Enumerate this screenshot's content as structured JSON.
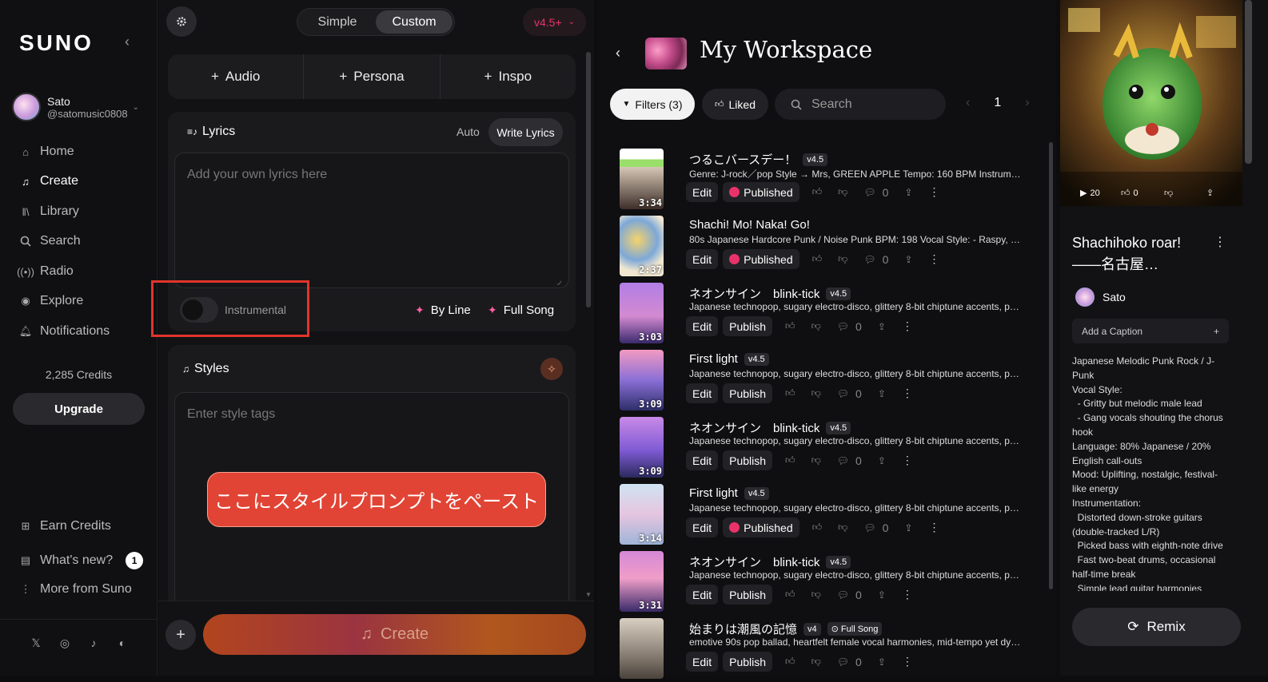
{
  "sidebar": {
    "logo": "SUNO",
    "user": {
      "name": "Sato",
      "handle": "@satomusic0808"
    },
    "nav": [
      {
        "label": "Home",
        "icon": "home-icon"
      },
      {
        "label": "Create",
        "icon": "create-icon"
      },
      {
        "label": "Library",
        "icon": "library-icon"
      },
      {
        "label": "Search",
        "icon": "search-icon"
      },
      {
        "label": "Radio",
        "icon": "radio-icon"
      },
      {
        "label": "Explore",
        "icon": "explore-icon"
      },
      {
        "label": "Notifications",
        "icon": "bell-icon"
      }
    ],
    "credits": "2,285 Credits",
    "upgrade": "Upgrade",
    "footer": [
      {
        "label": "Earn Credits",
        "icon": "gift-icon"
      },
      {
        "label": "What's new?",
        "icon": "news-icon",
        "badge": "1"
      },
      {
        "label": "More from Suno",
        "icon": "more-icon"
      }
    ],
    "social": [
      "x-icon",
      "instagram-icon",
      "tiktok-icon",
      "discord-icon"
    ]
  },
  "create": {
    "mode_simple": "Simple",
    "mode_custom": "Custom",
    "version": "v4.5+",
    "add_audio": "Audio",
    "add_persona": "Persona",
    "add_inspo": "Inspo",
    "lyrics_title": "Lyrics",
    "lyrics_auto": "Auto",
    "lyrics_write": "Write Lyrics",
    "lyrics_placeholder": "Add your own lyrics here",
    "instrumental": "Instrumental",
    "by_line": "By Line",
    "full_song": "Full Song",
    "styles_title": "Styles",
    "styles_placeholder": "Enter style tags",
    "callout": "ここにスタイルプロンプトをペースト",
    "create_button": "Create"
  },
  "workspace": {
    "title": "My Workspace",
    "filters": "Filters (3)",
    "liked": "Liked",
    "search_placeholder": "Search",
    "page": "1",
    "songs": [
      {
        "title": "つるこバースデー！",
        "version": "v4.5",
        "desc": "Genre: J-rock／pop Style → Mrs, GREEN APPLE Tempo: 160 BPM Instruments: • Electric guitars",
        "duration": "3:34",
        "status": "Published",
        "comments": "0"
      },
      {
        "title": "Shachi! Mo! Naka! Go!",
        "version": "",
        "desc": "80s Japanese Hardcore Punk / Noise Punk BPM: 198 Vocal Style: - Raspy, half-spoken shouting",
        "duration": "2:37",
        "status": "Published",
        "comments": "0"
      },
      {
        "title": "ネオンサイン　blink-tick",
        "version": "v4.5",
        "desc": "Japanese technopop, sugary electro-disco, glittery 8-bit chiptune accents, punchy four-on-the-floor",
        "duration": "3:03",
        "status": "Publish",
        "comments": "0"
      },
      {
        "title": "First light",
        "version": "v4.5",
        "desc": "Japanese technopop, sugary electro-disco, glittery 8-bit chiptune accents, punchy four-on-the-floor",
        "duration": "3:09",
        "status": "Publish",
        "comments": "0"
      },
      {
        "title": "ネオンサイン　blink-tick",
        "version": "v4.5",
        "desc": "Japanese technopop, sugary electro-disco, glittery 8-bit chiptune accents, punchy four-on-the-floor",
        "duration": "3:09",
        "status": "Publish",
        "comments": "0"
      },
      {
        "title": "First light",
        "version": "v4.5",
        "desc": "Japanese technopop, sugary electro-disco, glittery 8-bit chiptune accents, punchy four-on-the-floor",
        "duration": "3:14",
        "status": "Published",
        "comments": "0"
      },
      {
        "title": "ネオンサイン　blink-tick",
        "version": "v4.5",
        "desc": "Japanese technopop, sugary electro-disco, glittery 8-bit chiptune accents, punchy four-on-the-floor",
        "duration": "3:31",
        "status": "Publish",
        "comments": "0"
      },
      {
        "title": "始まりは潮風の記憶",
        "version": "v4",
        "extra_tag": "Full Song",
        "desc": "emotive 90s pop ballad, heartfelt female vocal harmonies, mid-tempo yet dynamic build",
        "duration": "",
        "status": "Publish",
        "comments": "0"
      }
    ],
    "edit_label": "Edit"
  },
  "detail": {
    "plays": "20",
    "likes": "0",
    "title": "Shachihoko roar! ——名古屋…",
    "user": "Sato",
    "caption": "Add a Caption",
    "description": "Japanese Melodic Punk Rock / J-Punk\nVocal Style:\n  - Gritty but melodic male lead\n  - Gang vocals shouting the chorus hook\nLanguage: 80% Japanese / 20% English call-outs\nMood: Uplifting, nostalgic, festival-like energy\nInstrumentation:\n  Distorted down-stroke guitars (double-tracked L/R)\n  Picked bass with eighth-note drive\n  Fast two-beat drums, occasional half-time break\n  Simple lead guitar harmonies (octave or",
    "remix": "Remix"
  },
  "colors": {
    "accent": "#e8336a",
    "callout": "#e14434",
    "highlight_box": "#e0352b"
  }
}
